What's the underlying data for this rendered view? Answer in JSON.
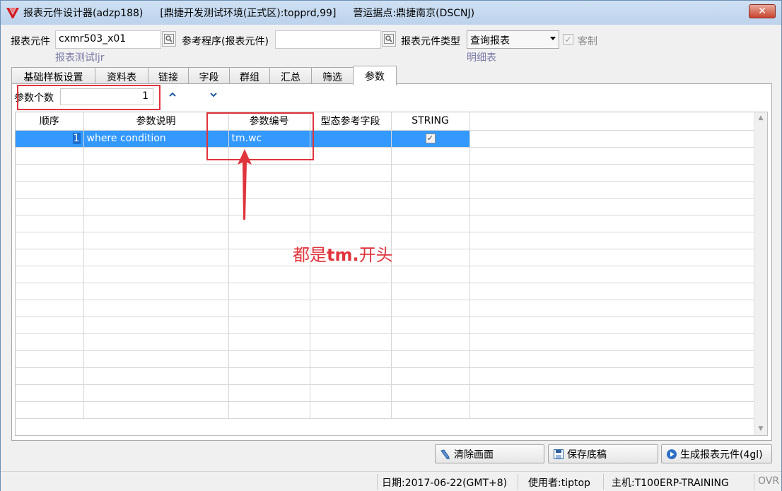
{
  "window": {
    "title": "报表元件设计器(adzp188)",
    "environment": "[鼎捷开发测试环境(正式区):topprd,99]",
    "site": "营运据点:鼎捷南京(DSCNJ)",
    "close_label": "✕"
  },
  "form": {
    "element_label": "报表元件",
    "element_value": "cxmr503_x01",
    "element_hint": "报表测试ljr",
    "ref_program_label": "参考程序(报表元件)",
    "ref_program_value": "",
    "element_type_label": "报表元件类型",
    "element_type_value": "查询报表",
    "element_type_hint": "明细表",
    "custom_label": "客制",
    "custom_checked": true
  },
  "tabs": [
    {
      "label": "基础样板设置",
      "active": false
    },
    {
      "label": "资料表",
      "active": false
    },
    {
      "label": "链接",
      "active": false
    },
    {
      "label": "字段",
      "active": false
    },
    {
      "label": "群组",
      "active": false
    },
    {
      "label": "汇总",
      "active": false
    },
    {
      "label": "筛选",
      "active": false
    },
    {
      "label": "参数",
      "active": true
    }
  ],
  "params": {
    "count_label": "参数个数",
    "count_value": "1",
    "up_icon": "chevron-up-icon",
    "down_icon": "chevron-down-icon"
  },
  "grid": {
    "columns": [
      "顺序",
      "参数说明",
      "参数编号",
      "型态参考字段",
      "STRING"
    ],
    "rows": [
      {
        "seq": "1",
        "description": "where condition",
        "param_id": "tm.wc",
        "type_ref": "",
        "string": true
      }
    ],
    "empty_rows": 16
  },
  "annotation": {
    "text_prefix": "都是",
    "text_bold": "tm.",
    "text_suffix": "开头",
    "color": "#e0343c"
  },
  "buttons": {
    "clear": "清除画面",
    "save": "保存底稿",
    "generate": "生成报表元件(4gl)"
  },
  "status": {
    "date": "日期:2017-06-22(GMT+8)",
    "user": "使用者:tiptop",
    "host": "主机:T100ERP-TRAINING",
    "mode": "OVR"
  }
}
